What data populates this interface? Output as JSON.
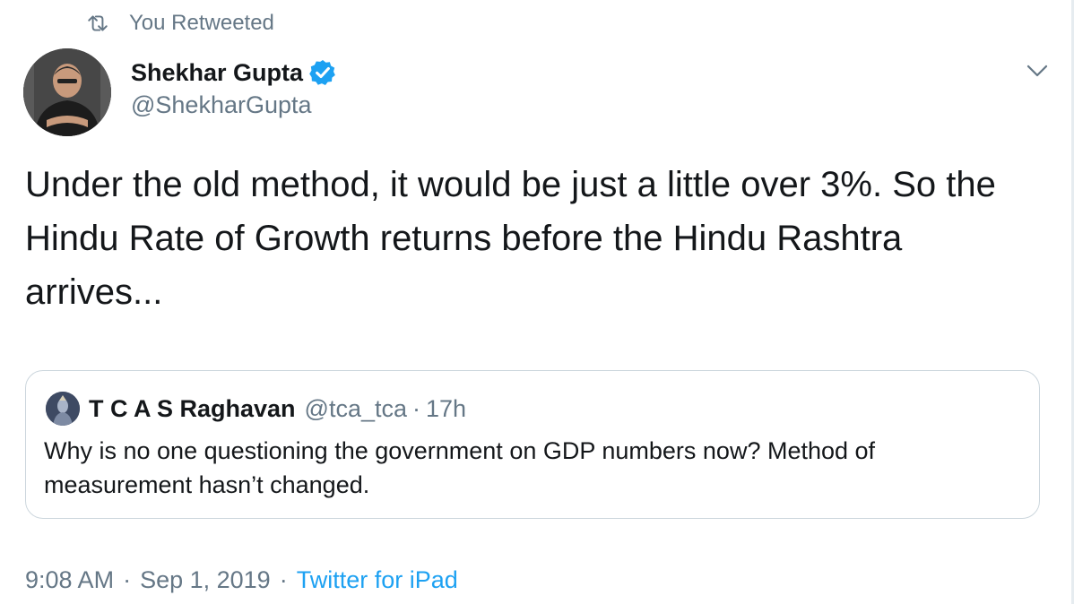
{
  "retweet": {
    "label": "You Retweeted",
    "icon": "retweet-icon"
  },
  "author": {
    "name": "Shekhar Gupta",
    "handle": "@ShekharGupta",
    "verified": true,
    "avatar_icon": "avatar"
  },
  "tweet": {
    "text": "Under the old method, it would be just a little over 3%. So the Hindu Rate of Growth returns before the Hindu Rashtra arrives..."
  },
  "quote": {
    "name": "T C A S Raghavan",
    "handle": "@tca_tca",
    "separator": "·",
    "time": "17h",
    "text": "Why is no one questioning the government on GDP numbers now? Method of measurement hasn’t changed."
  },
  "meta": {
    "time": "9:08 AM",
    "separator": "·",
    "date": "Sep 1, 2019",
    "source": "Twitter for iPad"
  },
  "colors": {
    "accent": "#1da1f2",
    "text_primary": "#14171a",
    "text_secondary": "#657786",
    "border": "#ccd6dd"
  }
}
